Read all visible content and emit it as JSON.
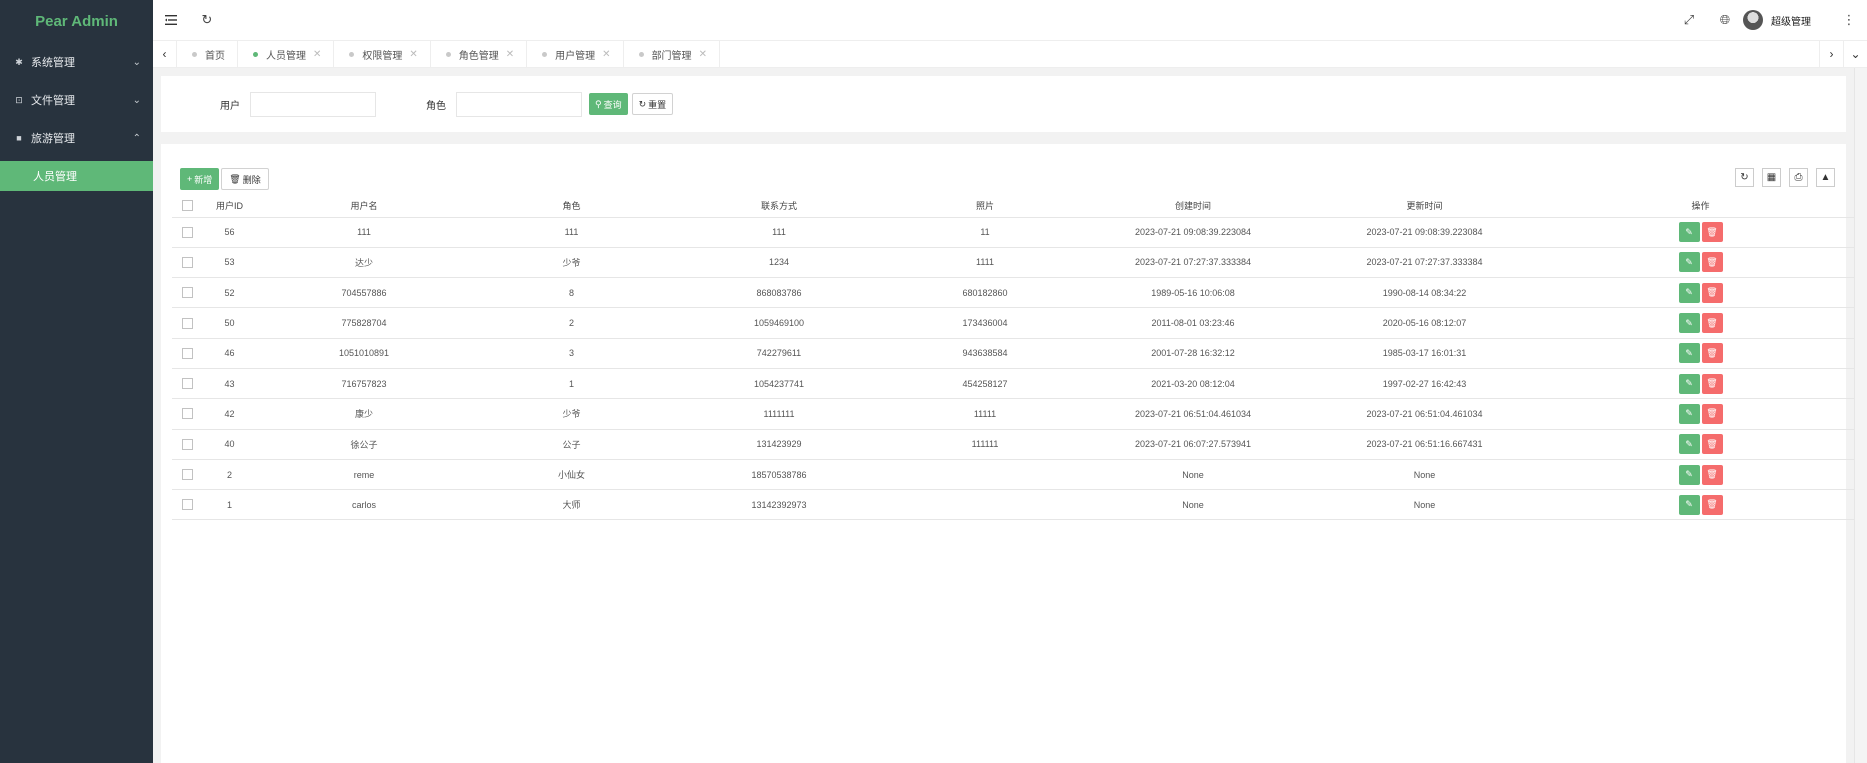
{
  "app": {
    "title": "Pear Admin"
  },
  "sidebar": {
    "menus": [
      {
        "label": "系统管理",
        "icon": "gear-icon",
        "glyph": "✱"
      },
      {
        "label": "文件管理",
        "icon": "folder-icon",
        "glyph": "⊡"
      },
      {
        "label": "旅游管理",
        "icon": "briefcase-icon",
        "glyph": "■"
      }
    ],
    "submenu": {
      "label": "人员管理"
    }
  },
  "header": {
    "user": "超级管理"
  },
  "tabs": [
    "首页",
    "人员管理",
    "权限管理",
    "角色管理",
    "用户管理",
    "部门管理"
  ],
  "search": {
    "user_label": "用户",
    "role_label": "角色",
    "query_label": "查询",
    "reset_label": "重置"
  },
  "toolbar": {
    "add_label": "新增",
    "delete_label": "删除"
  },
  "table": {
    "columns": [
      "用户ID",
      "用户名",
      "角色",
      "联系方式",
      "照片",
      "创建时间",
      "更新时间",
      "操作"
    ],
    "rows": [
      [
        "56",
        "111",
        "111",
        "111",
        "11",
        "2023-07-21 09:08:39.223084",
        "2023-07-21 09:08:39.223084"
      ],
      [
        "53",
        "达少",
        "少爷",
        "1234",
        "1111",
        "2023-07-21 07:27:37.333384",
        "2023-07-21 07:27:37.333384"
      ],
      [
        "52",
        "704557886",
        "8",
        "868083786",
        "680182860",
        "1989-05-16 10:06:08",
        "1990-08-14 08:34:22"
      ],
      [
        "50",
        "775828704",
        "2",
        "1059469100",
        "173436004",
        "2011-08-01 03:23:46",
        "2020-05-16 08:12:07"
      ],
      [
        "46",
        "1051010891",
        "3",
        "742279611",
        "943638584",
        "2001-07-28 16:32:12",
        "1985-03-17 16:01:31"
      ],
      [
        "43",
        "716757823",
        "1",
        "1054237741",
        "454258127",
        "2021-03-20 08:12:04",
        "1997-02-27 16:42:43"
      ],
      [
        "42",
        "康少",
        "少爷",
        "1111111",
        "11111",
        "2023-07-21 06:51:04.461034",
        "2023-07-21 06:51:04.461034"
      ],
      [
        "40",
        "徐公子",
        "公子",
        "131423929",
        "111111",
        "2023-07-21 06:07:27.573941",
        "2023-07-21 06:51:16.667431"
      ],
      [
        "2",
        "reme",
        "小仙女",
        "18570538786",
        "",
        "None",
        "None"
      ],
      [
        "1",
        "carlos",
        "大师",
        "13142392973",
        "",
        "None",
        "None"
      ]
    ]
  }
}
